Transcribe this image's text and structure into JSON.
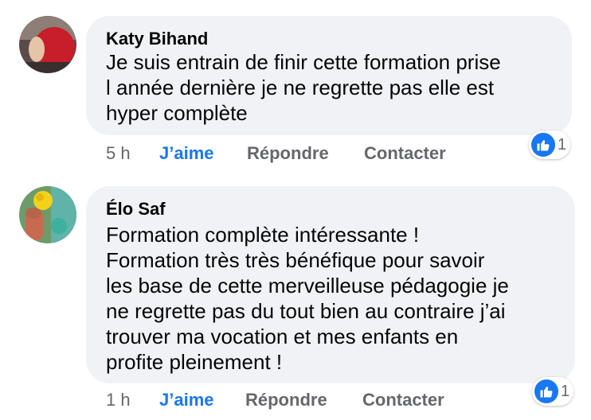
{
  "comments": [
    {
      "author": "Katy Bihand",
      "lines": [
        "Je suis entrain de finir cette formation prise",
        "l année dernière je ne regrette pas elle est",
        "hyper complète"
      ],
      "time": "5 h",
      "like_label": "J’aime",
      "reply_label": "Répondre",
      "contact_label": "Contacter",
      "reaction_count": "1"
    },
    {
      "author": "Élo Saf",
      "lines": [
        "Formation complète intéressante !",
        "Formation très très bénéfique pour savoir",
        "les base de cette merveilleuse pédagogie je",
        "ne regrette pas du tout bien au contraire j’ai",
        "trouver ma vocation et mes enfants en",
        "profite pleinement !"
      ],
      "time": "1 h",
      "like_label": "J’aime",
      "reply_label": "Répondre",
      "contact_label": "Contacter",
      "reaction_count": "1"
    }
  ],
  "colors": {
    "bubble": "#f0f2f5",
    "like_blue": "#1877f2",
    "action_gray": "#65676b",
    "text": "#050505"
  },
  "icons": {
    "reaction": "thumbs-up-icon"
  }
}
